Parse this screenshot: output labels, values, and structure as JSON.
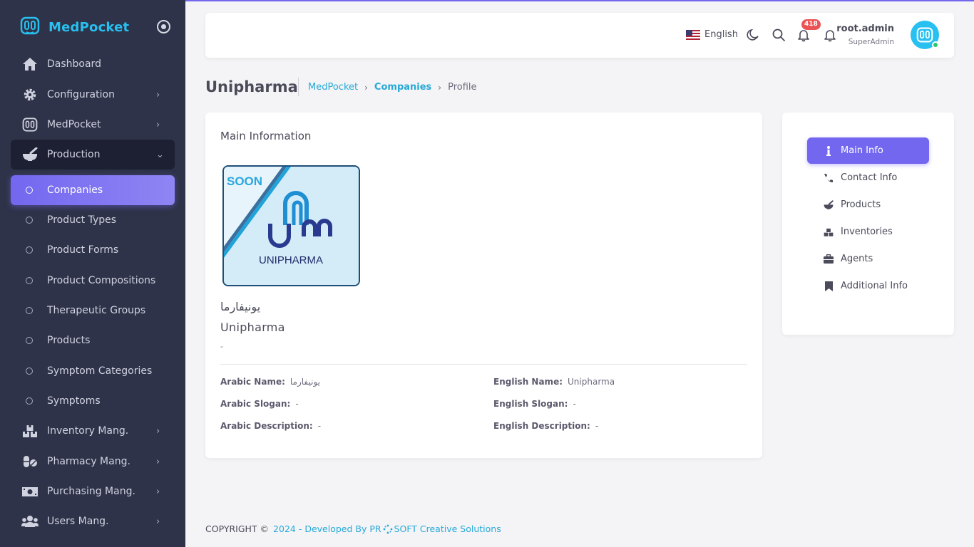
{
  "brand": {
    "name": "MedPocket",
    "accent": "#27c0f0"
  },
  "sidebar": {
    "items": [
      {
        "label": "Dashboard",
        "icon": "home-icon"
      },
      {
        "label": "Configuration",
        "icon": "gear-icon"
      },
      {
        "label": "MedPocket",
        "icon": "medpocket-icon"
      },
      {
        "label": "Production",
        "icon": "mortar-pestle-icon"
      },
      {
        "label": "Inventory Mang.",
        "icon": "boxes-icon"
      },
      {
        "label": "Pharmacy Mang.",
        "icon": "pills-icon"
      },
      {
        "label": "Purchasing Mang.",
        "icon": "money-icon"
      },
      {
        "label": "Users Mang.",
        "icon": "users-icon"
      }
    ],
    "production_sub": [
      "Companies",
      "Product Types",
      "Product Forms",
      "Product Compositions",
      "Therapeutic Groups",
      "Products",
      "Symptom Categories",
      "Symptoms"
    ]
  },
  "navbar": {
    "language": "English",
    "notifications_count": "418",
    "user_name": "root.admin",
    "user_role": "SuperAdmin"
  },
  "page": {
    "title": "Unipharma",
    "breadcrumb": [
      "MedPocket",
      "Companies",
      "Profile"
    ]
  },
  "main_card": {
    "title": "Main Information",
    "logo_text": "UNIPHARMA",
    "logo_badge": "SOON",
    "arabic_name": "يونيفارما",
    "english_name": "Unipharma",
    "slogan": "-",
    "fields": {
      "arabic_name_label": "Arabic Name:",
      "arabic_name_value": "يونيفارما",
      "english_name_label": "English Name:",
      "english_name_value": "Unipharma",
      "arabic_slogan_label": "Arabic Slogan:",
      "arabic_slogan_value": "-",
      "english_slogan_label": "English Slogan:",
      "english_slogan_value": "-",
      "arabic_desc_label": "Arabic Description:",
      "arabic_desc_value": "-",
      "english_desc_label": "English Description:",
      "english_desc_value": "-"
    }
  },
  "side_nav": [
    {
      "label": "Main Info",
      "icon": "info-icon"
    },
    {
      "label": "Contact Info",
      "icon": "phone-icon"
    },
    {
      "label": "Products",
      "icon": "mortar-pestle-icon"
    },
    {
      "label": "Inventories",
      "icon": "boxes-icon"
    },
    {
      "label": "Agents",
      "icon": "briefcase-icon"
    },
    {
      "label": "Additional Info",
      "icon": "bookmark-icon"
    }
  ],
  "footer": {
    "copyright": "COPYRIGHT ©",
    "credit_prefix": "2024 - Developed By PR",
    "credit_suffix": "SOFT Creative Solutions"
  },
  "colors": {
    "primary": "#7367f0",
    "sidebar": "#2f3349",
    "badge": "#ea5455",
    "online": "#28c76f"
  }
}
